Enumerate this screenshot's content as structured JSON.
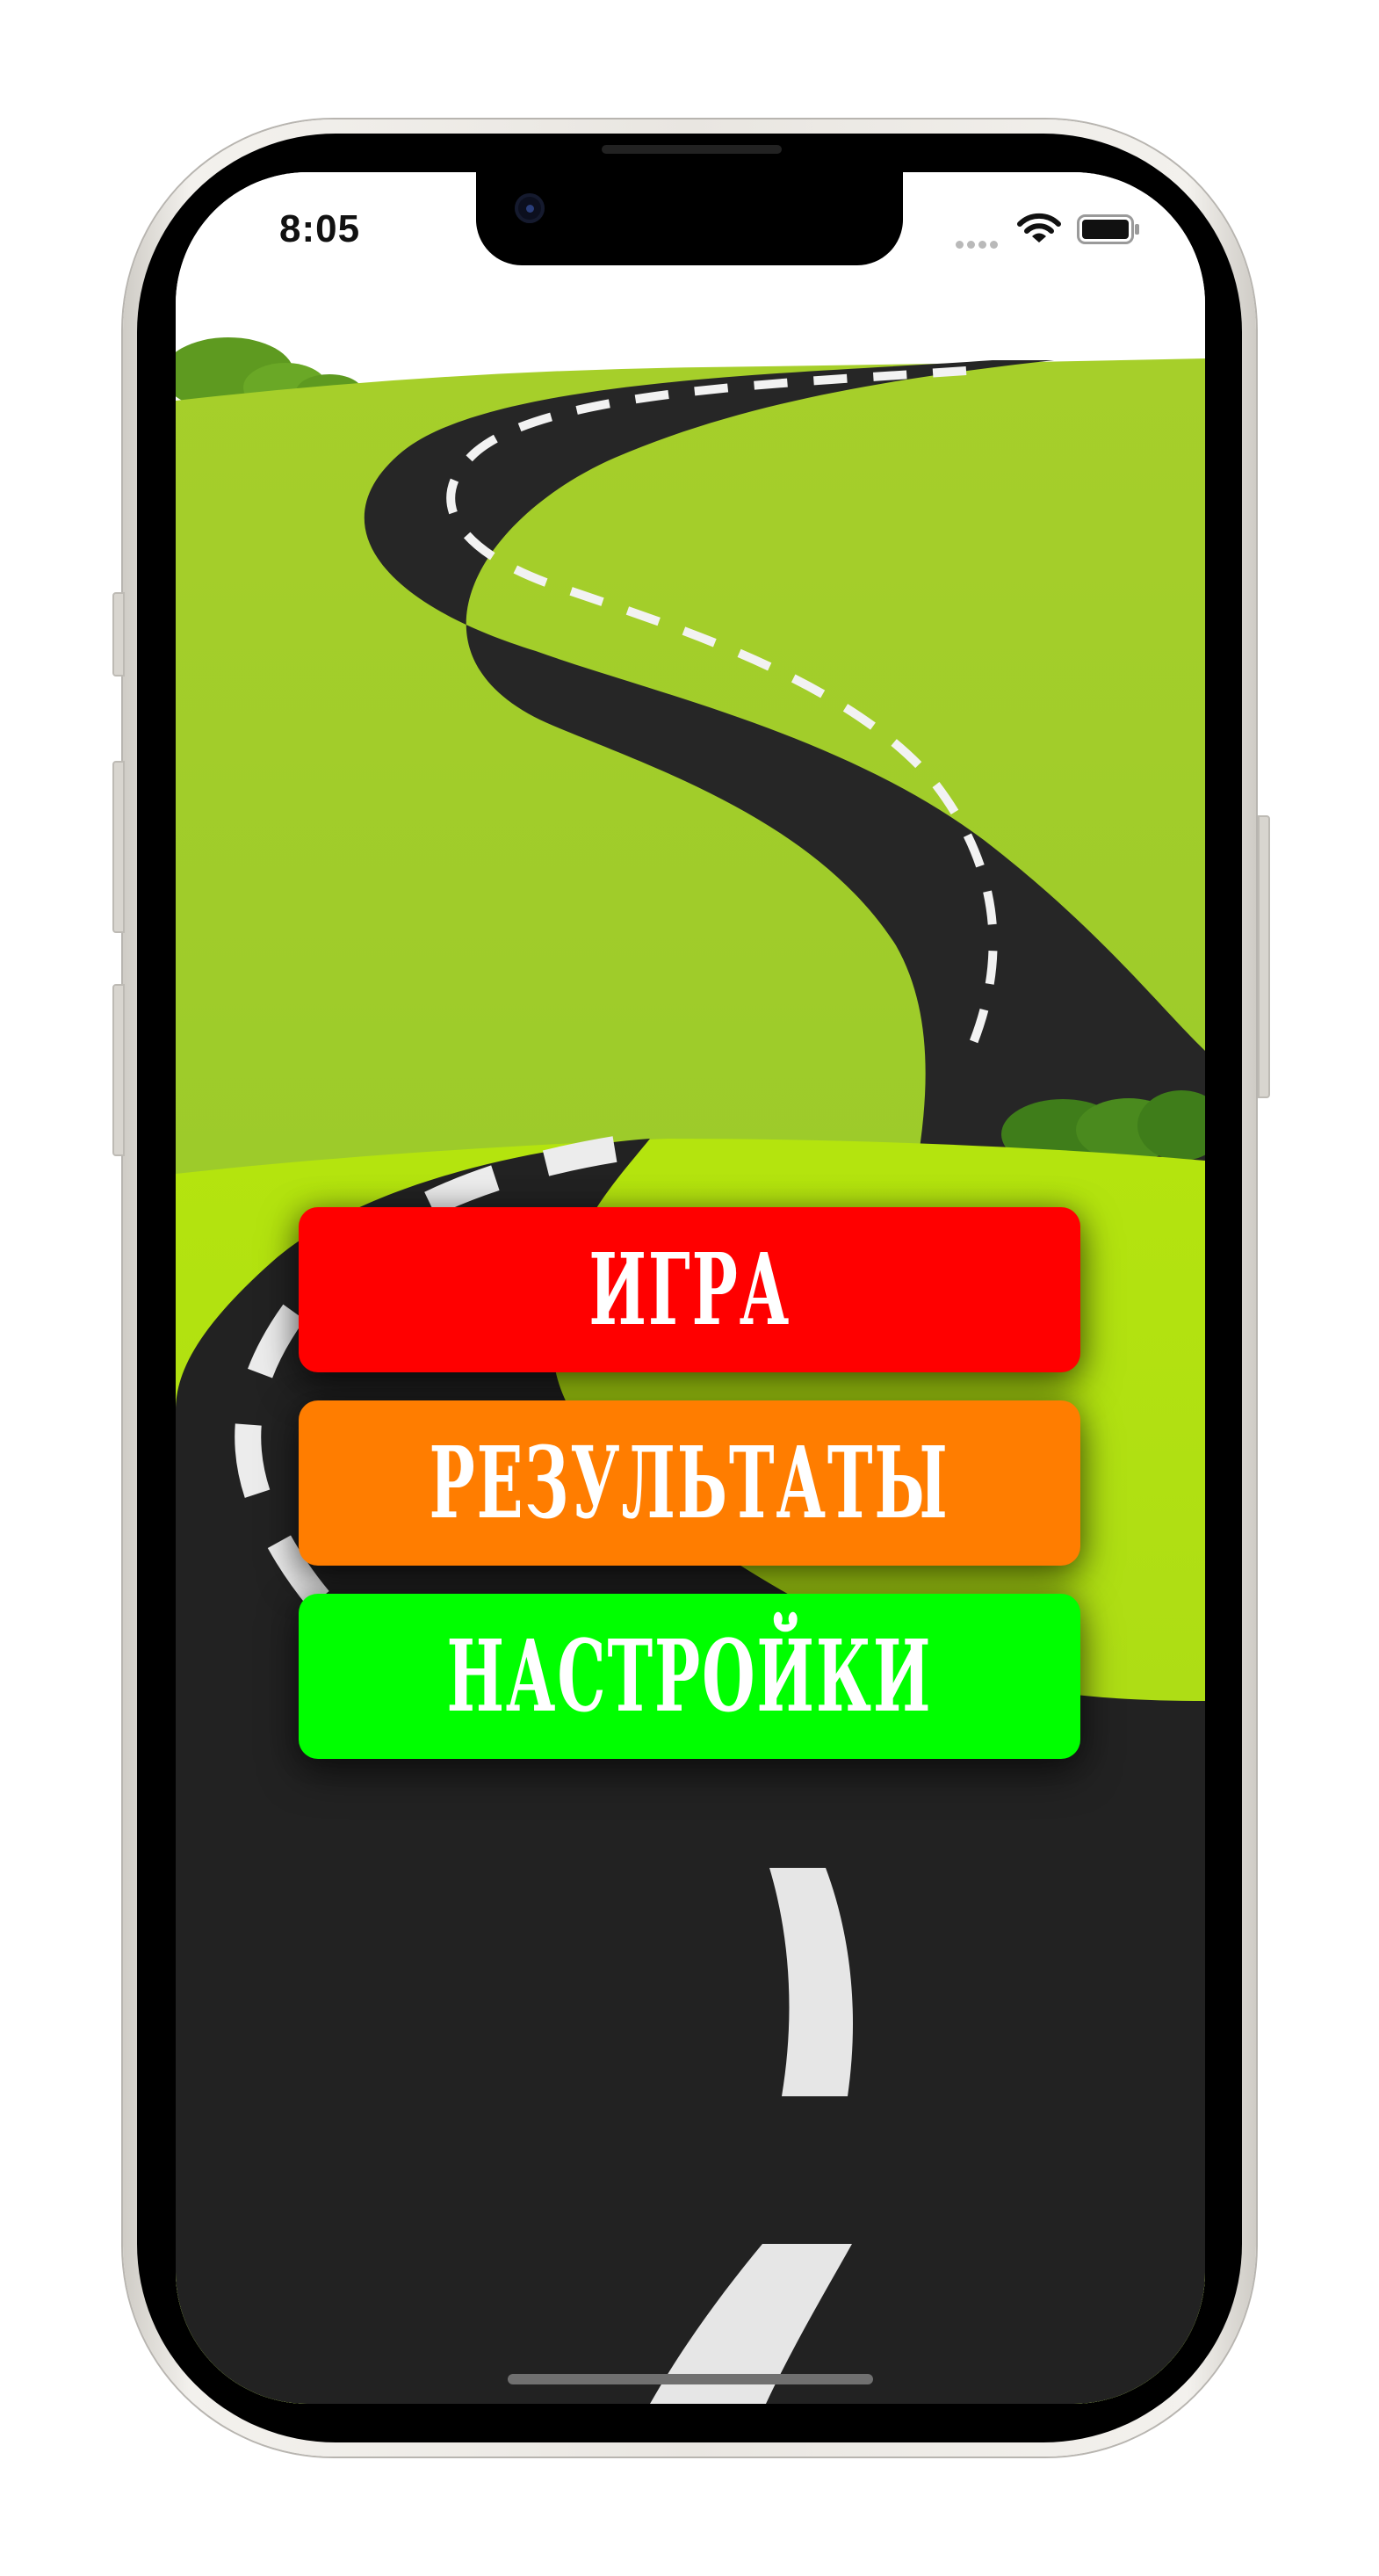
{
  "status_bar": {
    "time": "8:05"
  },
  "menu": {
    "play_label": "ИГРА",
    "results_label": "РЕЗУЛЬТАТЫ",
    "settings_label": "НАСТРОЙКИ"
  },
  "colors": {
    "play_button": "#ff0000",
    "results_button": "#ff7d00",
    "settings_button": "#00ff00",
    "road": "#222222",
    "grass": "#a6d41e"
  },
  "icons": [
    "camera-icon",
    "signal-icon",
    "wifi-icon",
    "battery-icon"
  ]
}
